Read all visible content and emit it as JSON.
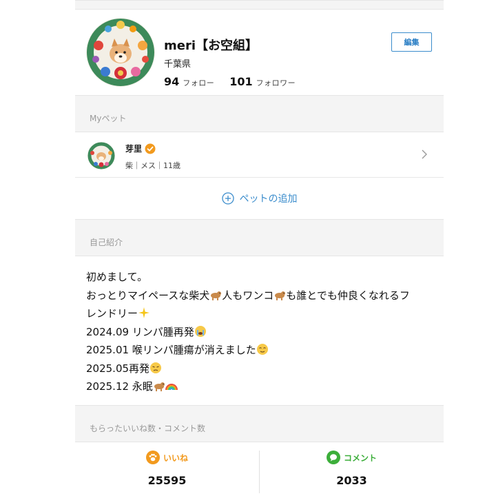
{
  "profile": {
    "name": "meri【お空組】",
    "location": "千葉県",
    "following_count": "94",
    "following_label": "フォロー",
    "followers_count": "101",
    "followers_label": "フォロワー",
    "edit_label": "編集",
    "avatar_icon": "shiba-flower-wreath-avatar"
  },
  "my_pets": {
    "heading": "Myペット",
    "pet": {
      "name": "芽里",
      "meta": "柴｜メス｜11歳",
      "verified_icon": "verified-badge-icon"
    },
    "add_label": "ペットの追加"
  },
  "bio": {
    "heading": "自己紹介",
    "lines": [
      "初めまして。",
      "おっとりマイペースな柴犬",
      "人もワンコ",
      "も誰とでも仲良くなれるフ",
      "レンドリー",
      "2024.09 リンパ腫再発",
      "2025.01 喉リンパ腫瘍が消えました",
      "2025.05再発",
      "2025.12 永眠"
    ]
  },
  "received": {
    "heading": "もらったいいね数・コメント数",
    "likes_label": "いいね",
    "likes_count": "25595",
    "comments_label": "コメント",
    "comments_count": "2033"
  },
  "colors": {
    "accent_blue": "#3a8ccc",
    "like_orange": "#f29a1e",
    "comment_green": "#3cae3a",
    "section_gray": "#f4f4f4"
  }
}
